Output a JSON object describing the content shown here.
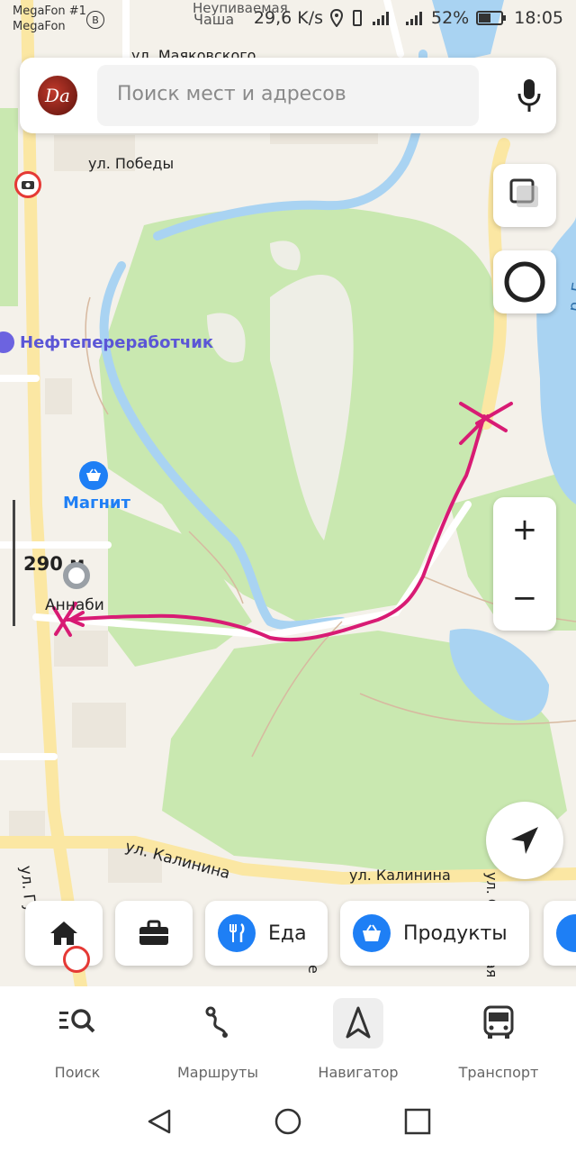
{
  "status": {
    "carrier1": "MegaFon #1",
    "carrier2": "MegaFon",
    "speed": "29,6 K/s",
    "battery": "52%",
    "time": "18:05"
  },
  "search": {
    "avatar_text": "Da",
    "placeholder": "Поиск мест и адресов"
  },
  "map": {
    "labels": {
      "top_clip": "Неупиваемая",
      "chasha": "Чаша",
      "mayakovskogo": "ул. Маяковского",
      "pobedy": "ул. Победы",
      "neft": "Нефтепереработчик",
      "magnit": "Магнит",
      "annabi": "Аннаби",
      "kalinina1": "ул. Калинина",
      "kalinina2": "ул. Калинина",
      "gubkina": "ул. Губкина",
      "river": "р. Бе",
      "sovetskaya": "ул. Советская",
      "bel": "Бе"
    },
    "scale": "290 м",
    "zoom_in": "+",
    "zoom_out": "−"
  },
  "chips": [
    {
      "name": "home",
      "label": ""
    },
    {
      "name": "work",
      "label": ""
    },
    {
      "name": "food",
      "label": "Еда"
    },
    {
      "name": "groceries",
      "label": "Продукты"
    }
  ],
  "tabs": [
    {
      "label": "Поиск"
    },
    {
      "label": "Маршруты"
    },
    {
      "label": "Навигатор"
    },
    {
      "label": "Транспорт"
    }
  ],
  "colors": {
    "accent": "#1e7ff5",
    "route": "#d81b74",
    "park": "#c9e8b0",
    "water": "#a9d3f2",
    "road": "#fbe7a3"
  }
}
